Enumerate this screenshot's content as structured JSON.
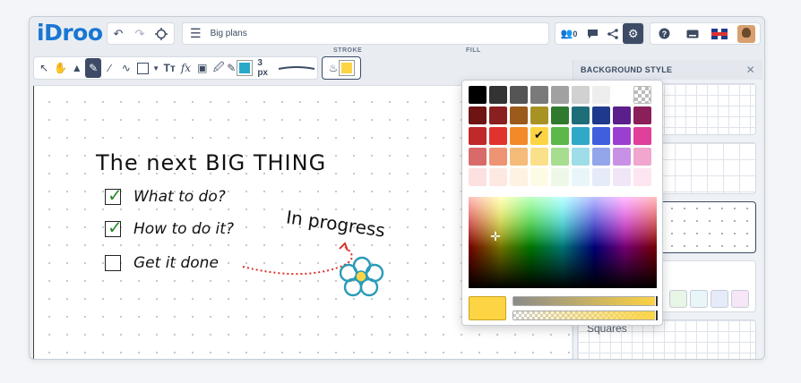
{
  "app": {
    "logo": "iDroo",
    "doc_name": "Big plans",
    "users_count": "0"
  },
  "toolbar": {
    "stroke_label": "STROKE",
    "fill_label": "FILL",
    "stroke_color": "#29a9c9",
    "fill_color": "#fdd443",
    "stroke_width": "3 px"
  },
  "canvas": {
    "title": "The next BIG THING",
    "tasks": [
      {
        "label": "What to do?",
        "checked": true
      },
      {
        "label": "How to do it?",
        "checked": true
      },
      {
        "label": "Get it done",
        "checked": false
      }
    ],
    "note": "In progress"
  },
  "panel": {
    "title": "BACKGROUND STYLE",
    "tile_label": "Squares"
  },
  "picker": {
    "selected_color": "#fdd443",
    "swatches": [
      "#000000",
      "#333333",
      "#555555",
      "#7a7a7a",
      "#a1a1a1",
      "#d1d1d1",
      "#eeeeee",
      "#ffffff",
      "transparent",
      "#6e1414",
      "#8a1f1f",
      "#9c5a1c",
      "#a89224",
      "#2f7a2f",
      "#1e6e7a",
      "#1f3a8c",
      "#5a1f8a",
      "#8a1f5a",
      "#c0282a",
      "#e0332d",
      "#f38a2a",
      "#fdd443",
      "#5cb84a",
      "#30a9c9",
      "#3f5fdc",
      "#9b3fd0",
      "#e03f9a",
      "#d96a6a",
      "#ee9474",
      "#f4bc78",
      "#fbe08a",
      "#a6dd8f",
      "#9fdde8",
      "#93a6ea",
      "#c891e5",
      "#f0a6ce",
      "#fde0e0",
      "#fde9e2",
      "#fef2e2",
      "#fefbe5",
      "#eef8e8",
      "#e8f6f9",
      "#e6ebfa",
      "#f0e6f8",
      "#fde6f1"
    ],
    "checked_index": 21
  },
  "panel_swatches": [
    "#e8f6e6",
    "#e8f6f9",
    "#e6ebfa",
    "#f6e6f8"
  ]
}
